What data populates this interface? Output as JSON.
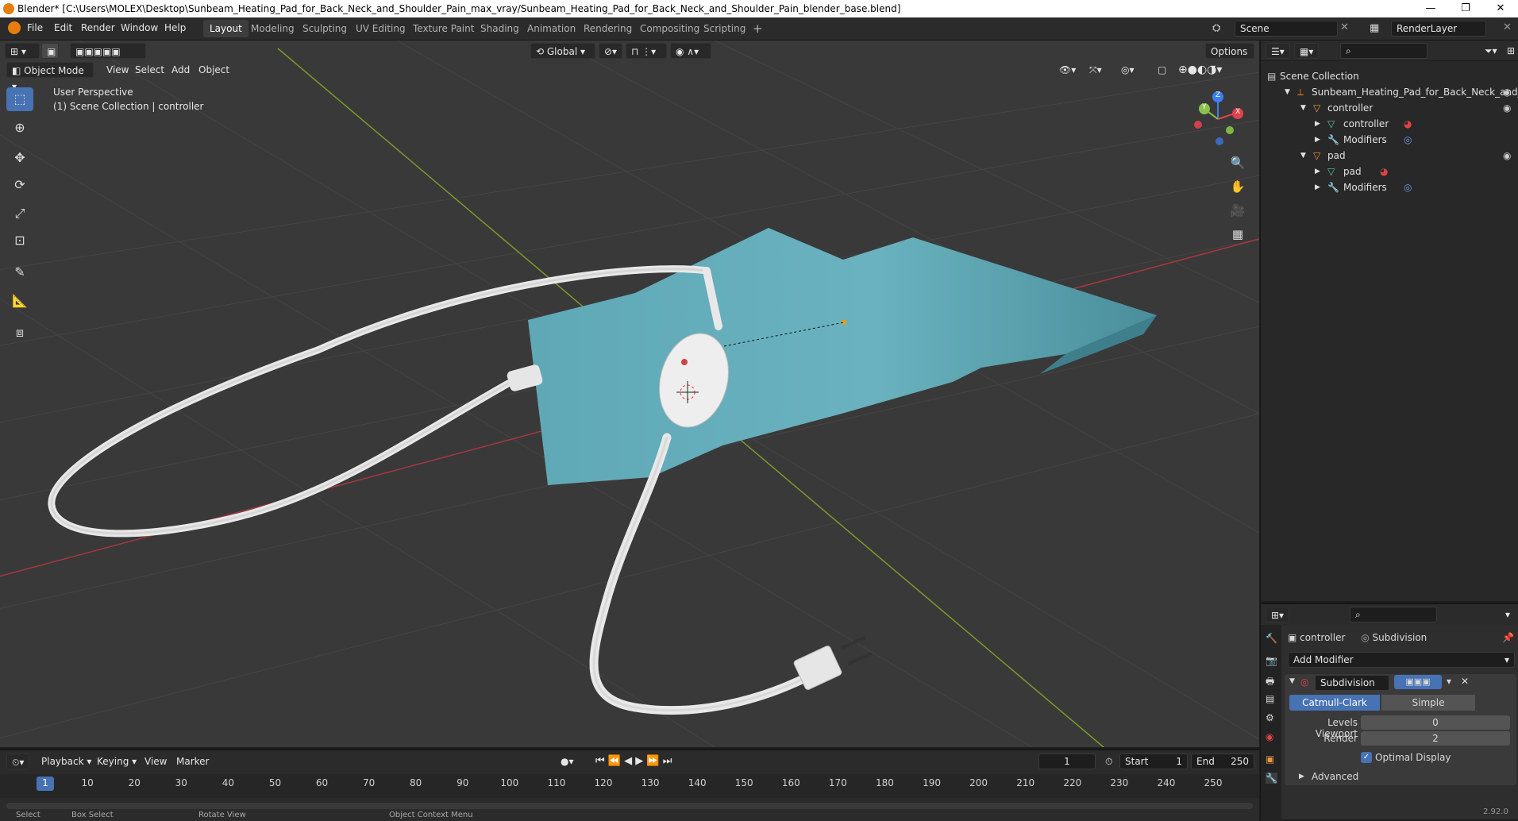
{
  "titlebar": {
    "title": "Blender* [C:\\Users\\MOLEX\\Desktop\\Sunbeam_Heating_Pad_for_Back_Neck_and_Shoulder_Pain_max_vray/Sunbeam_Heating_Pad_for_Back_Neck_and_Shoulder_Pain_blender_base.blend]",
    "minimize": "—",
    "maximize": "❐",
    "close": "✕"
  },
  "menus": [
    "File",
    "Edit",
    "Render",
    "Window",
    "Help"
  ],
  "workspaces": [
    "Layout",
    "Modeling",
    "Sculpting",
    "UV Editing",
    "Texture Paint",
    "Shading",
    "Animation",
    "Rendering",
    "Compositing",
    "Scripting"
  ],
  "scene": {
    "label": "Scene",
    "render_layer": "RenderLayer"
  },
  "viewport_header": {
    "mode": "Object Mode",
    "menus": [
      "View",
      "Select",
      "Add",
      "Object"
    ],
    "transform_orientation": "Global",
    "options": "Options"
  },
  "viewport": {
    "perspective": "User Perspective",
    "collection_info": "(1) Scene Collection | controller",
    "axes": {
      "x": "X",
      "y": "Y",
      "z": "Z"
    },
    "colors": {
      "bg": "#393939",
      "grid": "#434343",
      "x_axis": "#a8373f",
      "y_axis": "#7b9a2a",
      "pad": "#5fa8b6",
      "pad_dark": "#4a8e9b",
      "cable": "#e6e6e6"
    }
  },
  "outliner": {
    "root": "Scene Collection",
    "items": [
      {
        "label": "Sunbeam_Heating_Pad_for_Back_Neck_and_",
        "indent": 1
      },
      {
        "label": "controller",
        "indent": 2
      },
      {
        "label": "controller",
        "indent": 3
      },
      {
        "label": "Modifiers",
        "indent": 3
      },
      {
        "label": "pad",
        "indent": 2
      },
      {
        "label": "pad",
        "indent": 3
      },
      {
        "label": "Modifiers",
        "indent": 3
      }
    ]
  },
  "properties": {
    "object": "controller",
    "modifier_crumb": "Subdivision",
    "add_modifier": "Add Modifier",
    "modifier_name": "Subdivision",
    "algorithm_active": "Catmull-Clark",
    "algorithm_other": "Simple",
    "levels_viewport_label": "Levels Viewport",
    "levels_viewport_value": "0",
    "render_label": "Render",
    "render_value": "2",
    "optimal_display": "Optimal Display",
    "advanced": "Advanced",
    "version": "2.92.0"
  },
  "timeline": {
    "menus": [
      "Playback",
      "Keying",
      "View",
      "Marker"
    ],
    "current_frame": "1",
    "start_label": "Start",
    "start_value": "1",
    "end_label": "End",
    "end_value": "250",
    "ticks": [
      "1",
      "10",
      "20",
      "30",
      "40",
      "50",
      "60",
      "70",
      "80",
      "90",
      "100",
      "110",
      "120",
      "130",
      "140",
      "150",
      "160",
      "170",
      "180",
      "190",
      "200",
      "210",
      "220",
      "230",
      "240",
      "250"
    ]
  },
  "statusbar": {
    "select": "Select",
    "box_select": "Box Select",
    "rotate": "Rotate View",
    "context": "Object Context Menu"
  }
}
